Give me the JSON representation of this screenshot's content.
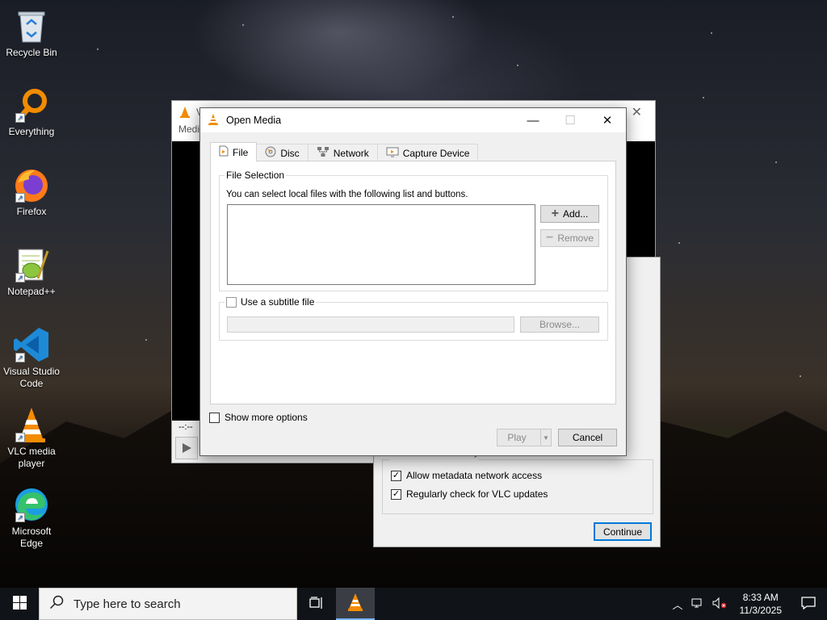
{
  "desktop": {
    "icons": [
      {
        "label": "Recycle Bin",
        "icon": "recycle-bin-icon"
      },
      {
        "label": "Everything",
        "icon": "everything-search-icon"
      },
      {
        "label": "Firefox",
        "icon": "firefox-icon"
      },
      {
        "label": "Notepad++",
        "icon": "notepad-plus-plus-icon"
      },
      {
        "label": "Visual Studio Code",
        "icon": "vscode-icon"
      },
      {
        "label": "VLC media player",
        "icon": "vlc-icon"
      },
      {
        "label": "Microsoft Edge",
        "icon": "edge-icon"
      }
    ]
  },
  "vlc_main": {
    "title_partial": "V",
    "menu_partial": "Medi",
    "time_left": "--:--",
    "time_right": "--:--"
  },
  "privacy_dialog": {
    "group_title_partial": "Network Access Policy",
    "allow_metadata_label": "Allow metadata network access",
    "allow_metadata_checked": true,
    "check_updates_label": "Regularly check for VLC updates",
    "check_updates_checked": true,
    "continue_label": "Continue"
  },
  "open_media": {
    "title": "Open Media",
    "tabs": [
      {
        "label": "File",
        "icon": "file-icon",
        "active": true
      },
      {
        "label": "Disc",
        "icon": "disc-icon",
        "active": false
      },
      {
        "label": "Network",
        "icon": "network-icon",
        "active": false
      },
      {
        "label": "Capture Device",
        "icon": "capture-device-icon",
        "active": false
      }
    ],
    "file_selection": {
      "legend": "File Selection",
      "description": "You can select local files with the following list and buttons.",
      "add_label": "Add...",
      "remove_label": "Remove"
    },
    "subtitle": {
      "label": "Use a subtitle file",
      "checked": false,
      "browse_label": "Browse..."
    },
    "show_more_label": "Show more options",
    "show_more_checked": false,
    "play_label": "Play",
    "cancel_label": "Cancel"
  },
  "taskbar": {
    "search_placeholder": "Type here to search",
    "time": "8:33 AM",
    "date": "11/3/2025"
  },
  "colors": {
    "accent": "#0078d7",
    "vlc_orange": "#f28c00",
    "taskbar": "#101418"
  }
}
